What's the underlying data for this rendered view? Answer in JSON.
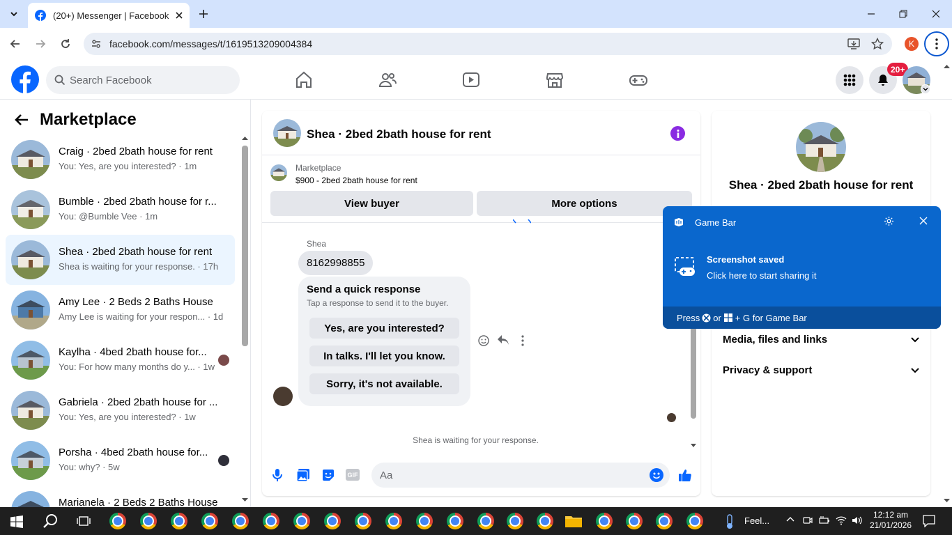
{
  "browser": {
    "tab_title": "(20+) Messenger | Facebook",
    "url": "facebook.com/messages/t/1619513209004384",
    "profile_initial": "K"
  },
  "fb": {
    "search_placeholder": "Search Facebook",
    "notif_badge": "20+"
  },
  "left": {
    "title": "Marketplace",
    "chats": [
      {
        "name": "Craig · 2bed 2bath house for rent",
        "preview": "You: Yes, are you interested? · 1m"
      },
      {
        "name": "Bumble · 2bed 2bath house for r...",
        "preview": "You: @Bumble Vee · 1m"
      },
      {
        "name": "Shea · 2bed 2bath house for rent",
        "preview": "Shea is waiting for your response. · 17h"
      },
      {
        "name": "Amy Lee · 2 Beds 2 Baths House",
        "preview": "Amy Lee is waiting for your respon... · 1d"
      },
      {
        "name": "Kaylha · 4bed 2bath house for...",
        "preview": "You: For how many months do y... · 1w"
      },
      {
        "name": "Gabriela · 2bed 2bath house for ...",
        "preview": "You: Yes, are you interested? · 1w"
      },
      {
        "name": "Porsha · 4bed 2bath house for...",
        "preview": "You: why? · 5w"
      },
      {
        "name": "Marianela · 2 Beds 2 Baths House",
        "preview": ""
      }
    ]
  },
  "chat": {
    "header_title": "Shea · 2bed 2bath house for rent",
    "listing_category": "Marketplace",
    "listing_title": "$900 - 2bed 2bath house for rent",
    "view_buyer": "View buyer",
    "more_options": "More options",
    "sender_name": "Shea",
    "message": "8162998855",
    "quick_title": "Send a quick response",
    "quick_sub": "Tap a response to send it to the buyer.",
    "quick_options": [
      "Yes, are you interested?",
      "In talks. I'll let you know.",
      "Sorry, it's not available."
    ],
    "waiting": "Shea is waiting for your response.",
    "composer_placeholder": "Aa"
  },
  "right": {
    "name": "Shea · 2bed 2bath house for rent",
    "rows": [
      "Media, files and links",
      "Privacy & support"
    ]
  },
  "gamebar": {
    "title": "Game Bar",
    "heading": "Screenshot saved",
    "sub": "Click here to start sharing it",
    "footer_press": "Press",
    "footer_or": "or",
    "footer_rest": "+ G for Game Bar"
  },
  "taskbar": {
    "weather": "Feel...",
    "time": "12:12 am",
    "date": "21/01/2026"
  },
  "colors": {
    "fb_blue": "#0866ff",
    "gamebar_blue": "#0a67cd",
    "badge_red": "#e41e3f"
  }
}
